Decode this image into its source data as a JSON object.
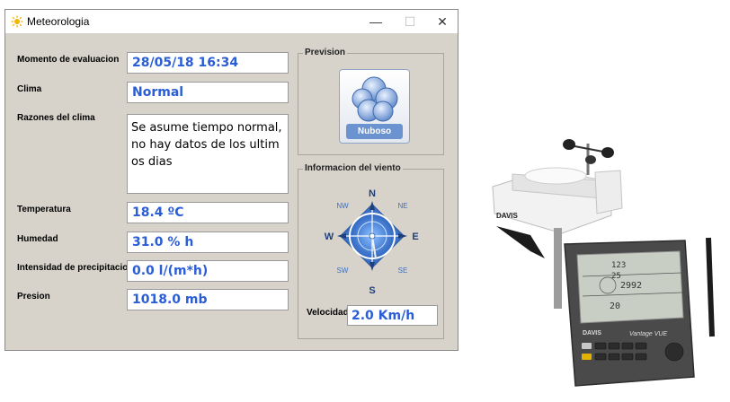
{
  "window": {
    "title": "Meteorologia",
    "controls": {
      "minimize": "—",
      "maximize": "☐",
      "close": "✕"
    }
  },
  "fields": {
    "momento": {
      "label": "Momento de evaluacion",
      "value": "28/05/18 16:34"
    },
    "clima": {
      "label": "Clima",
      "value": "Normal"
    },
    "razones": {
      "label": "Razones del clima",
      "value": "Se asume tiempo normal, no hay datos de los ultimos dias"
    },
    "temperatura": {
      "label": "Temperatura",
      "value": "18.4 ºC"
    },
    "humedad": {
      "label": "Humedad",
      "value": "31.0 % h"
    },
    "precipitacion": {
      "label": "Intensidad de precipitacion",
      "value": "0.0 l/(m*h)"
    },
    "presion": {
      "label": "Presion",
      "value": "1018.0 mb"
    }
  },
  "prevision": {
    "group_title": "Prevision",
    "icon": "cloud-icon",
    "label": "Nuboso"
  },
  "viento": {
    "group_title": "Informacion del viento",
    "compass": {
      "N": "N",
      "NE": "NE",
      "E": "E",
      "SE": "SE",
      "S": "S",
      "SW": "SW",
      "W": "W",
      "NW": "NW"
    },
    "velocidad_label": "Velocidad",
    "velocidad_value": "2.0 Km/h"
  },
  "device": {
    "brand": "DAVIS",
    "model": "Vantage VUE",
    "console_readings": [
      "123",
      "25",
      "2992",
      "20"
    ]
  },
  "colors": {
    "value_text": "#2a5dd6",
    "window_bg": "#d7d3cb",
    "compass_blue": "#3a6fc4"
  }
}
